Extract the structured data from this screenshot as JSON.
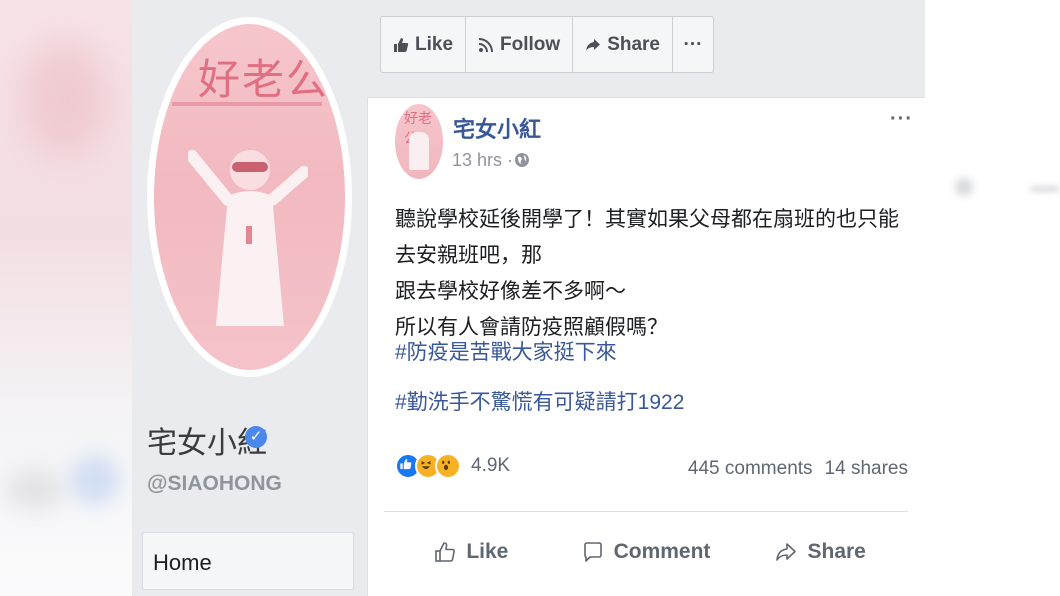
{
  "page": {
    "profile_name": "宅女小紅",
    "handle": "@SIAOHONG",
    "home_label": "Home",
    "cover_title": "好老公"
  },
  "toolbar": {
    "like_label": "Like",
    "follow_label": "Follow",
    "share_label": "Share",
    "more_label": "···"
  },
  "post": {
    "author": "宅女小紅",
    "time": "13 hrs ·",
    "more_label": "···",
    "text_line1": "聽說學校延後開學了！其實如果父母都在扇班的也只能去安親班吧，那",
    "text_line2": "跟去學校好像差不多啊～",
    "text_line3": "所以有人會請防疫照顧假嗎？",
    "hashtag1": "#防疫是苦戰大家挺下來",
    "hashtag2": "#勤洗手不驚慌有可疑請打1922",
    "reaction_count": "4.9K",
    "comments": "445 comments",
    "shares": "14 shares",
    "actions": {
      "like": "Like",
      "comment": "Comment",
      "share": "Share"
    }
  },
  "colors": {
    "link_blue": "#385898",
    "verified_blue": "#4a88ee",
    "page_bg": "#e9ebee"
  }
}
